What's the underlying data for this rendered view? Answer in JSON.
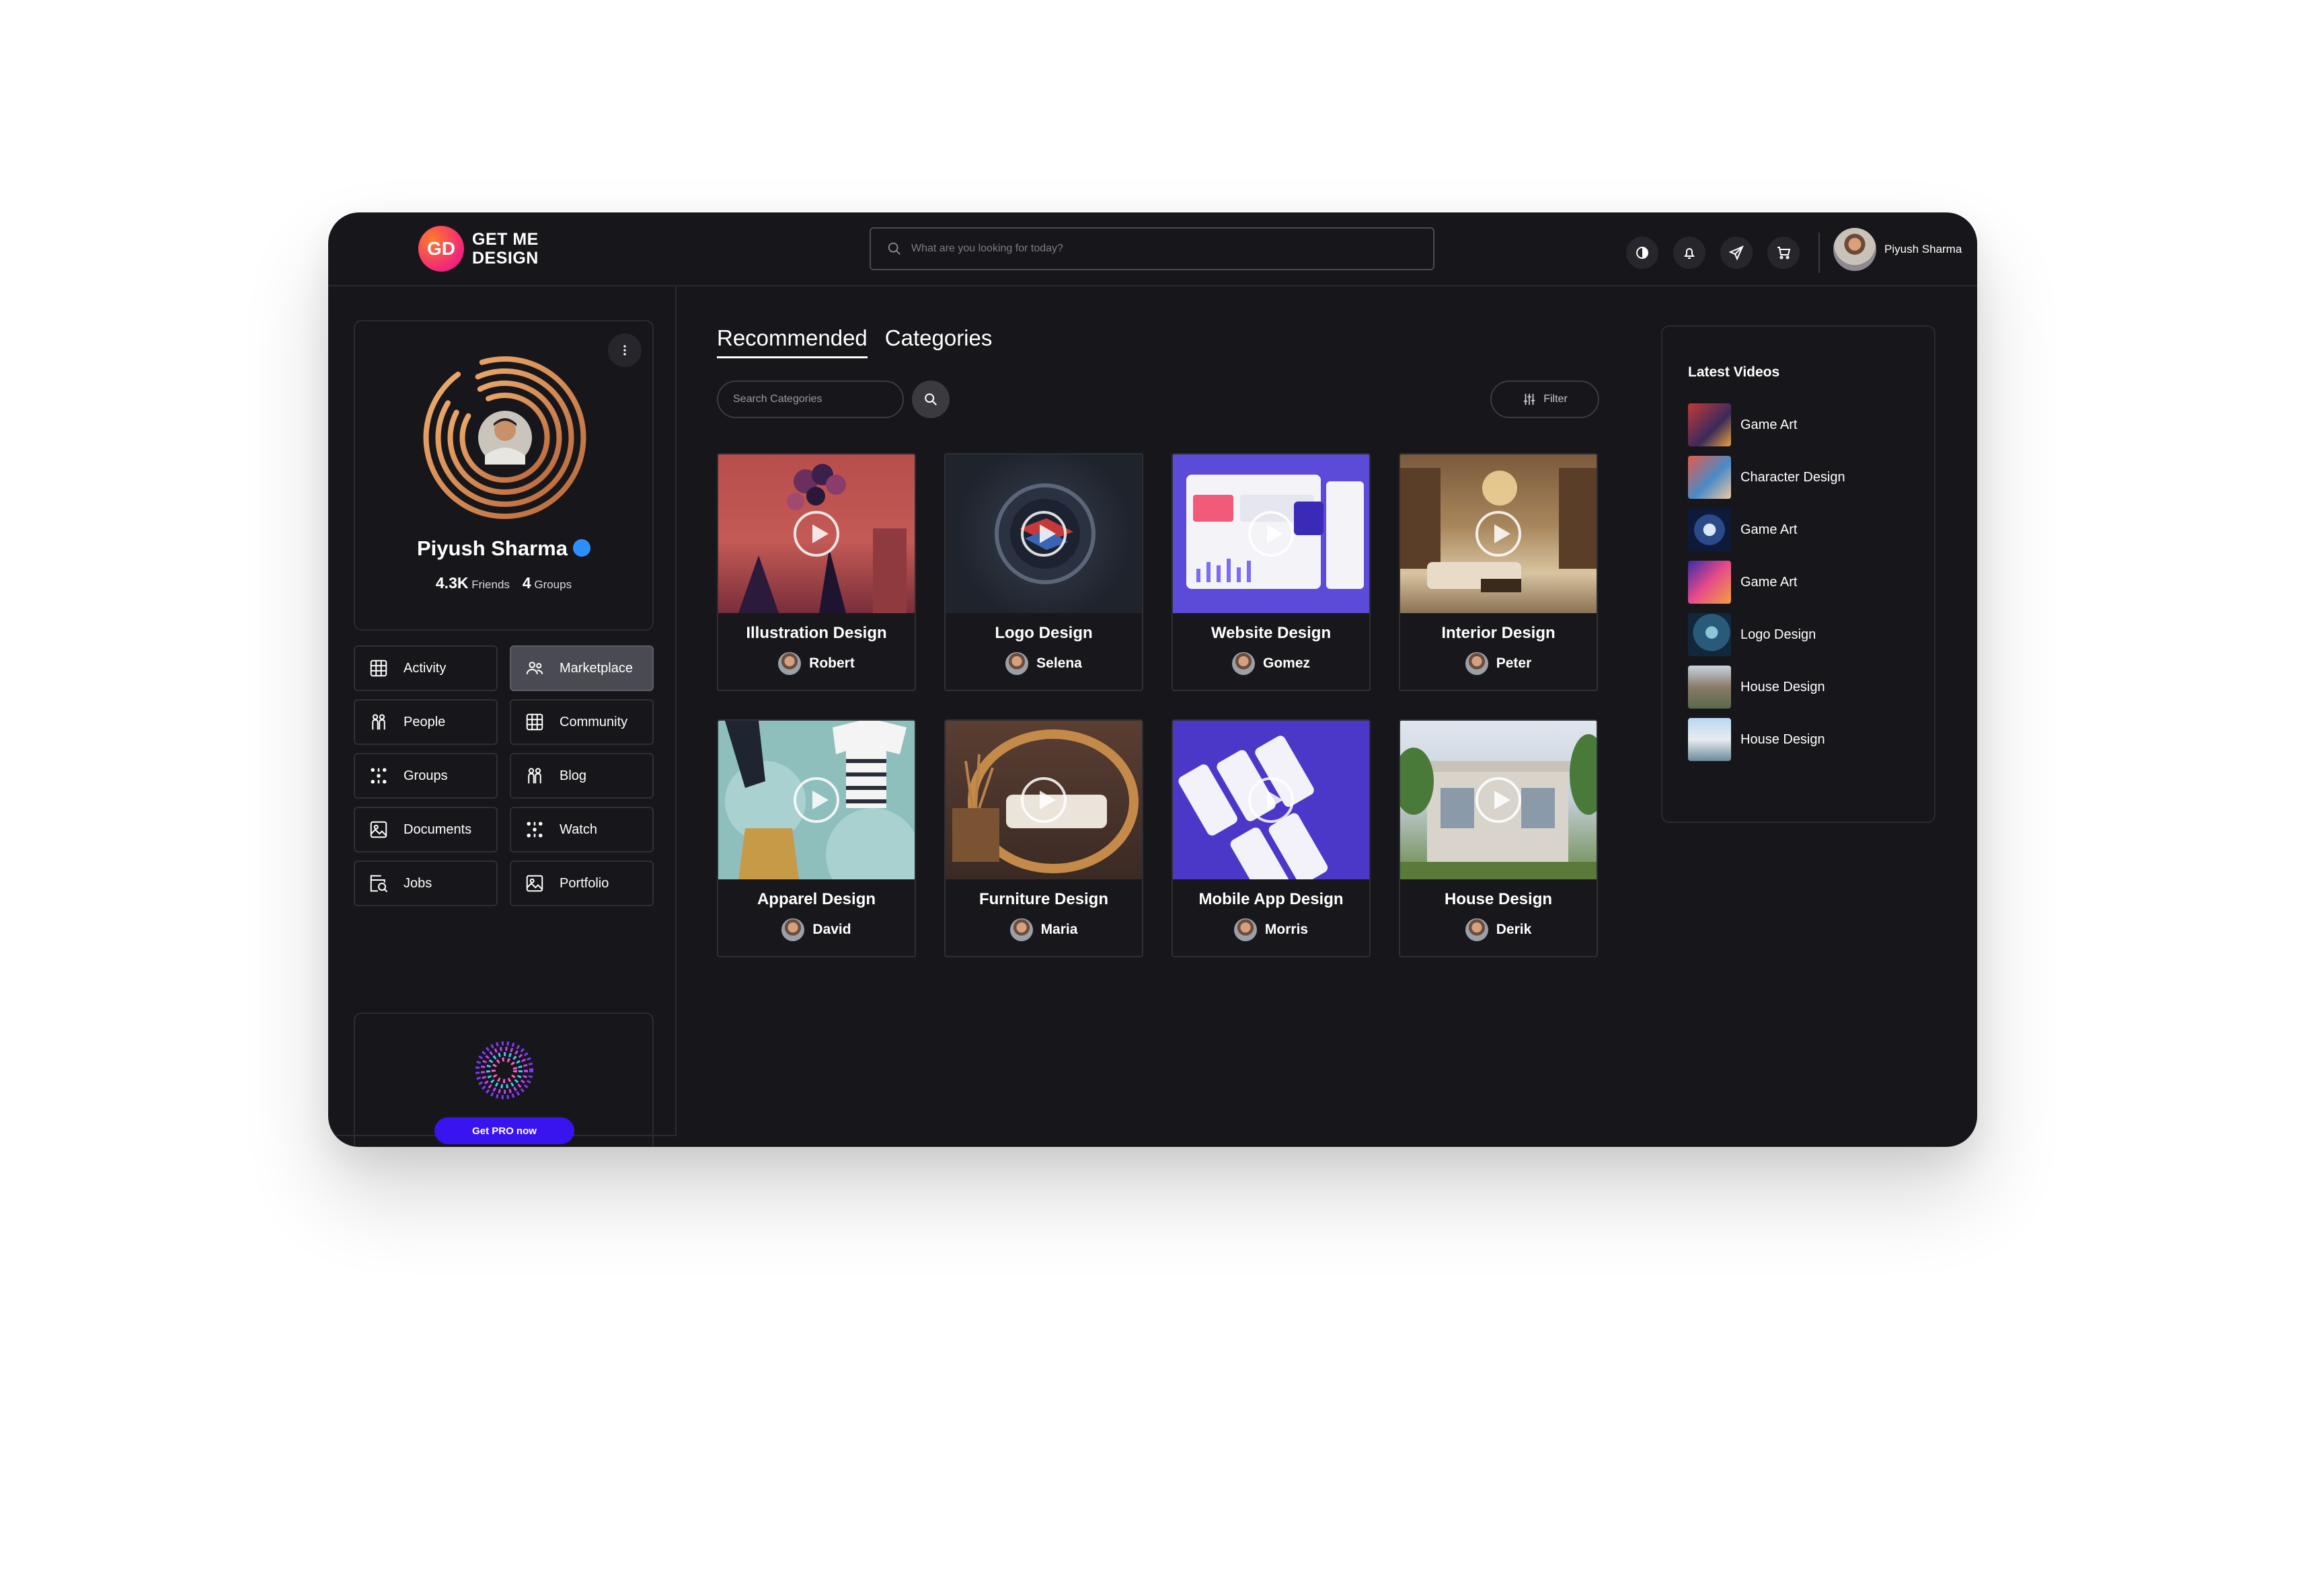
{
  "brand": {
    "logo_mark": "GD",
    "name_line1": "GET ME",
    "name_line2": "DESIGN",
    "primary_color": "#ff5a3c"
  },
  "search": {
    "placeholder": "What are you looking for today?"
  },
  "header_icons": [
    "contrast-icon",
    "bell-icon",
    "send-icon",
    "cart-icon"
  ],
  "user": {
    "name": "Piyush Sharma"
  },
  "profile": {
    "name": "Piyush Sharma",
    "friends_count": "4.3K",
    "friends_label": "Friends",
    "groups_count": "4",
    "groups_label": "Groups",
    "verified_color": "#2d8fff"
  },
  "nav": [
    {
      "label": "Activity",
      "icon": "grid-icon"
    },
    {
      "label": "Marketplace",
      "icon": "people-icon",
      "active": true
    },
    {
      "label": "People",
      "icon": "people-icon"
    },
    {
      "label": "Community",
      "icon": "grid-icon"
    },
    {
      "label": "Groups",
      "icon": "dots-grid-icon"
    },
    {
      "label": "Blog",
      "icon": "people-icon"
    },
    {
      "label": "Documents",
      "icon": "image-icon"
    },
    {
      "label": "Watch",
      "icon": "dots-grid-icon"
    },
    {
      "label": "Jobs",
      "icon": "search-doc-icon"
    },
    {
      "label": "Portfolio",
      "icon": "image-icon"
    }
  ],
  "pro": {
    "button_label": "Get PRO now",
    "button_color": "#3a14ee"
  },
  "tabs": [
    {
      "label": "Recommended",
      "active": true
    },
    {
      "label": "Categories",
      "active": false
    }
  ],
  "category_search": {
    "placeholder": "Search Categories"
  },
  "filter": {
    "label": "Filter"
  },
  "cards": [
    {
      "title": "Illustration Design",
      "author": "Robert"
    },
    {
      "title": "Logo Design",
      "author": "Selena"
    },
    {
      "title": "Website Design",
      "author": "Gomez"
    },
    {
      "title": "Interior Design",
      "author": "Peter"
    },
    {
      "title": "Apparel Design",
      "author": "David"
    },
    {
      "title": "Furniture Design",
      "author": "Maria"
    },
    {
      "title": "Mobile App Design",
      "author": "Morris"
    },
    {
      "title": "House Design",
      "author": "Derik"
    }
  ],
  "latest_videos": {
    "title": "Latest Videos",
    "items": [
      {
        "label": "Game Art"
      },
      {
        "label": "Character Design"
      },
      {
        "label": "Game Art"
      },
      {
        "label": "Game Art"
      },
      {
        "label": "Logo Design"
      },
      {
        "label": "House Design"
      },
      {
        "label": "House Design"
      }
    ]
  }
}
